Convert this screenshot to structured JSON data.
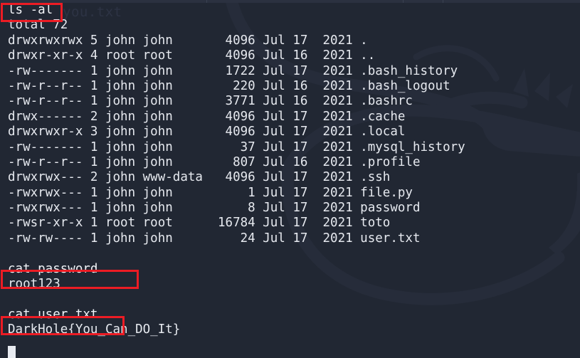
{
  "terminal": {
    "background_color": "#212733",
    "text_color": "#e6e9ef",
    "highlight_color": "#ec1c24",
    "ghost_text": "you.txt",
    "cursor": "block-cursor"
  },
  "session": {
    "commands": [
      {
        "name": "ls-al",
        "command": "ls -al",
        "highlighted": true,
        "summary": "total 72",
        "listing": [
          {
            "perms": "drwxrwxrwx",
            "links": "5",
            "owner": "john",
            "group": "john",
            "size": "4096",
            "month": "Jul",
            "day": "17",
            "year": "2021",
            "name": "."
          },
          {
            "perms": "drwxr-xr-x",
            "links": "4",
            "owner": "root",
            "group": "root",
            "size": "4096",
            "month": "Jul",
            "day": "16",
            "year": "2021",
            "name": ".."
          },
          {
            "perms": "-rw-------",
            "links": "1",
            "owner": "john",
            "group": "john",
            "size": "1722",
            "month": "Jul",
            "day": "17",
            "year": "2021",
            "name": ".bash_history"
          },
          {
            "perms": "-rw-r--r--",
            "links": "1",
            "owner": "john",
            "group": "john",
            "size": "220",
            "month": "Jul",
            "day": "16",
            "year": "2021",
            "name": ".bash_logout"
          },
          {
            "perms": "-rw-r--r--",
            "links": "1",
            "owner": "john",
            "group": "john",
            "size": "3771",
            "month": "Jul",
            "day": "16",
            "year": "2021",
            "name": ".bashrc"
          },
          {
            "perms": "drwx------",
            "links": "2",
            "owner": "john",
            "group": "john",
            "size": "4096",
            "month": "Jul",
            "day": "17",
            "year": "2021",
            "name": ".cache"
          },
          {
            "perms": "drwxrwxr-x",
            "links": "3",
            "owner": "john",
            "group": "john",
            "size": "4096",
            "month": "Jul",
            "day": "17",
            "year": "2021",
            "name": ".local"
          },
          {
            "perms": "-rw-------",
            "links": "1",
            "owner": "john",
            "group": "john",
            "size": "37",
            "month": "Jul",
            "day": "17",
            "year": "2021",
            "name": ".mysql_history"
          },
          {
            "perms": "-rw-r--r--",
            "links": "1",
            "owner": "john",
            "group": "john",
            "size": "807",
            "month": "Jul",
            "day": "16",
            "year": "2021",
            "name": ".profile"
          },
          {
            "perms": "drwxrwx---",
            "links": "2",
            "owner": "john",
            "group": "www-data",
            "size": "4096",
            "month": "Jul",
            "day": "17",
            "year": "2021",
            "name": ".ssh"
          },
          {
            "perms": "-rwxrwx---",
            "links": "1",
            "owner": "john",
            "group": "john",
            "size": "1",
            "month": "Jul",
            "day": "17",
            "year": "2021",
            "name": "file.py"
          },
          {
            "perms": "-rwxrwx---",
            "links": "1",
            "owner": "john",
            "group": "john",
            "size": "8",
            "month": "Jul",
            "day": "17",
            "year": "2021",
            "name": "password"
          },
          {
            "perms": "-rwsr-xr-x",
            "links": "1",
            "owner": "root",
            "group": "root",
            "size": "16784",
            "month": "Jul",
            "day": "17",
            "year": "2021",
            "name": "toto"
          },
          {
            "perms": "-rw-rw----",
            "links": "1",
            "owner": "john",
            "group": "john",
            "size": "24",
            "month": "Jul",
            "day": "17",
            "year": "2021",
            "name": "user.txt"
          }
        ]
      },
      {
        "name": "cat-password",
        "command": "cat password",
        "highlighted": true,
        "output": "root123"
      },
      {
        "name": "cat-user-txt",
        "command": "cat user.txt",
        "highlighted": true,
        "output": "DarkHole{You_Can_DO_It}"
      }
    ]
  }
}
